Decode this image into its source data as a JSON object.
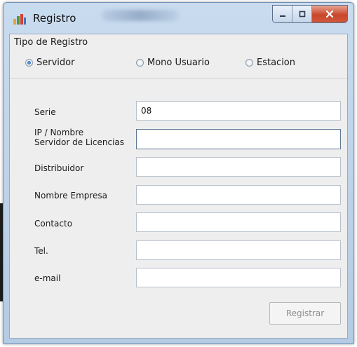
{
  "window": {
    "title": "Registro",
    "icon": "bar-chart-icon",
    "controls": [
      "minimize-icon",
      "maximize-icon",
      "close-icon"
    ]
  },
  "registro_tipo": {
    "label": "Tipo de Registro",
    "options": [
      {
        "label": "Servidor",
        "checked": true
      },
      {
        "label": "Mono Usuario",
        "checked": false
      },
      {
        "label": "Estacion",
        "checked": false
      }
    ]
  },
  "form": {
    "serie": {
      "label": "Serie",
      "value": "08"
    },
    "ip_nombre": {
      "label_line1": "IP / Nombre",
      "label_line2": "Servidor de Licencias",
      "value": ""
    },
    "distribuidor": {
      "label": "Distribuidor",
      "value": ""
    },
    "nombre_empresa": {
      "label": "Nombre Empresa",
      "value": ""
    },
    "contacto": {
      "label": "Contacto",
      "value": ""
    },
    "tel": {
      "label": "Tel.",
      "value": ""
    },
    "email": {
      "label": "e-mail",
      "value": ""
    }
  },
  "actions": {
    "registrar_label": "Registrar",
    "registrar_enabled": false
  },
  "colors": {
    "title_bar": "#c9dcef",
    "client_background": "#eeeeee",
    "close_button": "#c9472c"
  }
}
